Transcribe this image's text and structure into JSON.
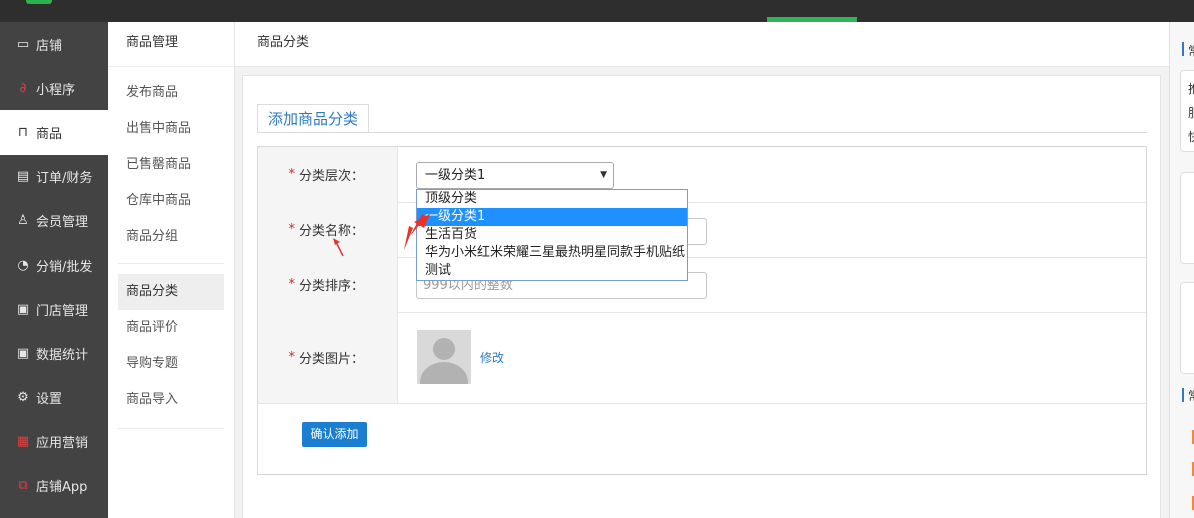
{
  "side_nav": {
    "items": [
      {
        "label": "店铺",
        "icon": "shop-icon",
        "glyph": "▭"
      },
      {
        "label": "小程序",
        "icon": "miniprogram-icon",
        "glyph": "∂"
      },
      {
        "label": "商品",
        "icon": "bag-icon",
        "glyph": "⊓"
      },
      {
        "label": "订单/财务",
        "icon": "order-icon",
        "glyph": "▤"
      },
      {
        "label": "会员管理",
        "icon": "member-icon",
        "glyph": "♙"
      },
      {
        "label": "分销/批发",
        "icon": "distribution-icon",
        "glyph": "◔"
      },
      {
        "label": "门店管理",
        "icon": "store-icon",
        "glyph": "▣"
      },
      {
        "label": "数据统计",
        "icon": "stats-icon",
        "glyph": "▣"
      },
      {
        "label": "设置",
        "icon": "gear-icon",
        "glyph": "⚙"
      },
      {
        "label": "应用营销",
        "icon": "apps-icon",
        "glyph": "▦"
      },
      {
        "label": "店铺App",
        "icon": "app-icon",
        "glyph": "⧉"
      }
    ]
  },
  "sub_nav": {
    "title": "商品管理",
    "group1": [
      "发布商品",
      "出售中商品",
      "已售罄商品",
      "仓库中商品",
      "商品分组"
    ],
    "group2": [
      "商品分类",
      "商品评价",
      "导购专题",
      "商品导入"
    ]
  },
  "breadcrumb": "商品分类",
  "tab_label": "添加商品分类",
  "form": {
    "level_label": "分类层次：",
    "level_value": "一级分类1",
    "name_label": "分类名称：",
    "sort_label": "分类排序：",
    "sort_placeholder": "999以内的整数",
    "image_label": "分类图片：",
    "edit_link": "修改",
    "submit": "确认添加",
    "required_mark": "*"
  },
  "dropdown_options": [
    "顶级分类",
    "一级分类1",
    "生活百货",
    "华为小米红米荣耀三星最热明星同款手机贴纸",
    "测试"
  ],
  "right_panel": {
    "chars": [
      "常",
      "推",
      "服",
      "快",
      "常"
    ]
  },
  "colors": {
    "sidebar_bg": "#434343",
    "accent_blue": "#1b7ed0",
    "link_blue": "#2e7ac4",
    "selected_option": "#1e90ff",
    "required_red": "#e02020",
    "arrow_red": "#e8322e"
  }
}
